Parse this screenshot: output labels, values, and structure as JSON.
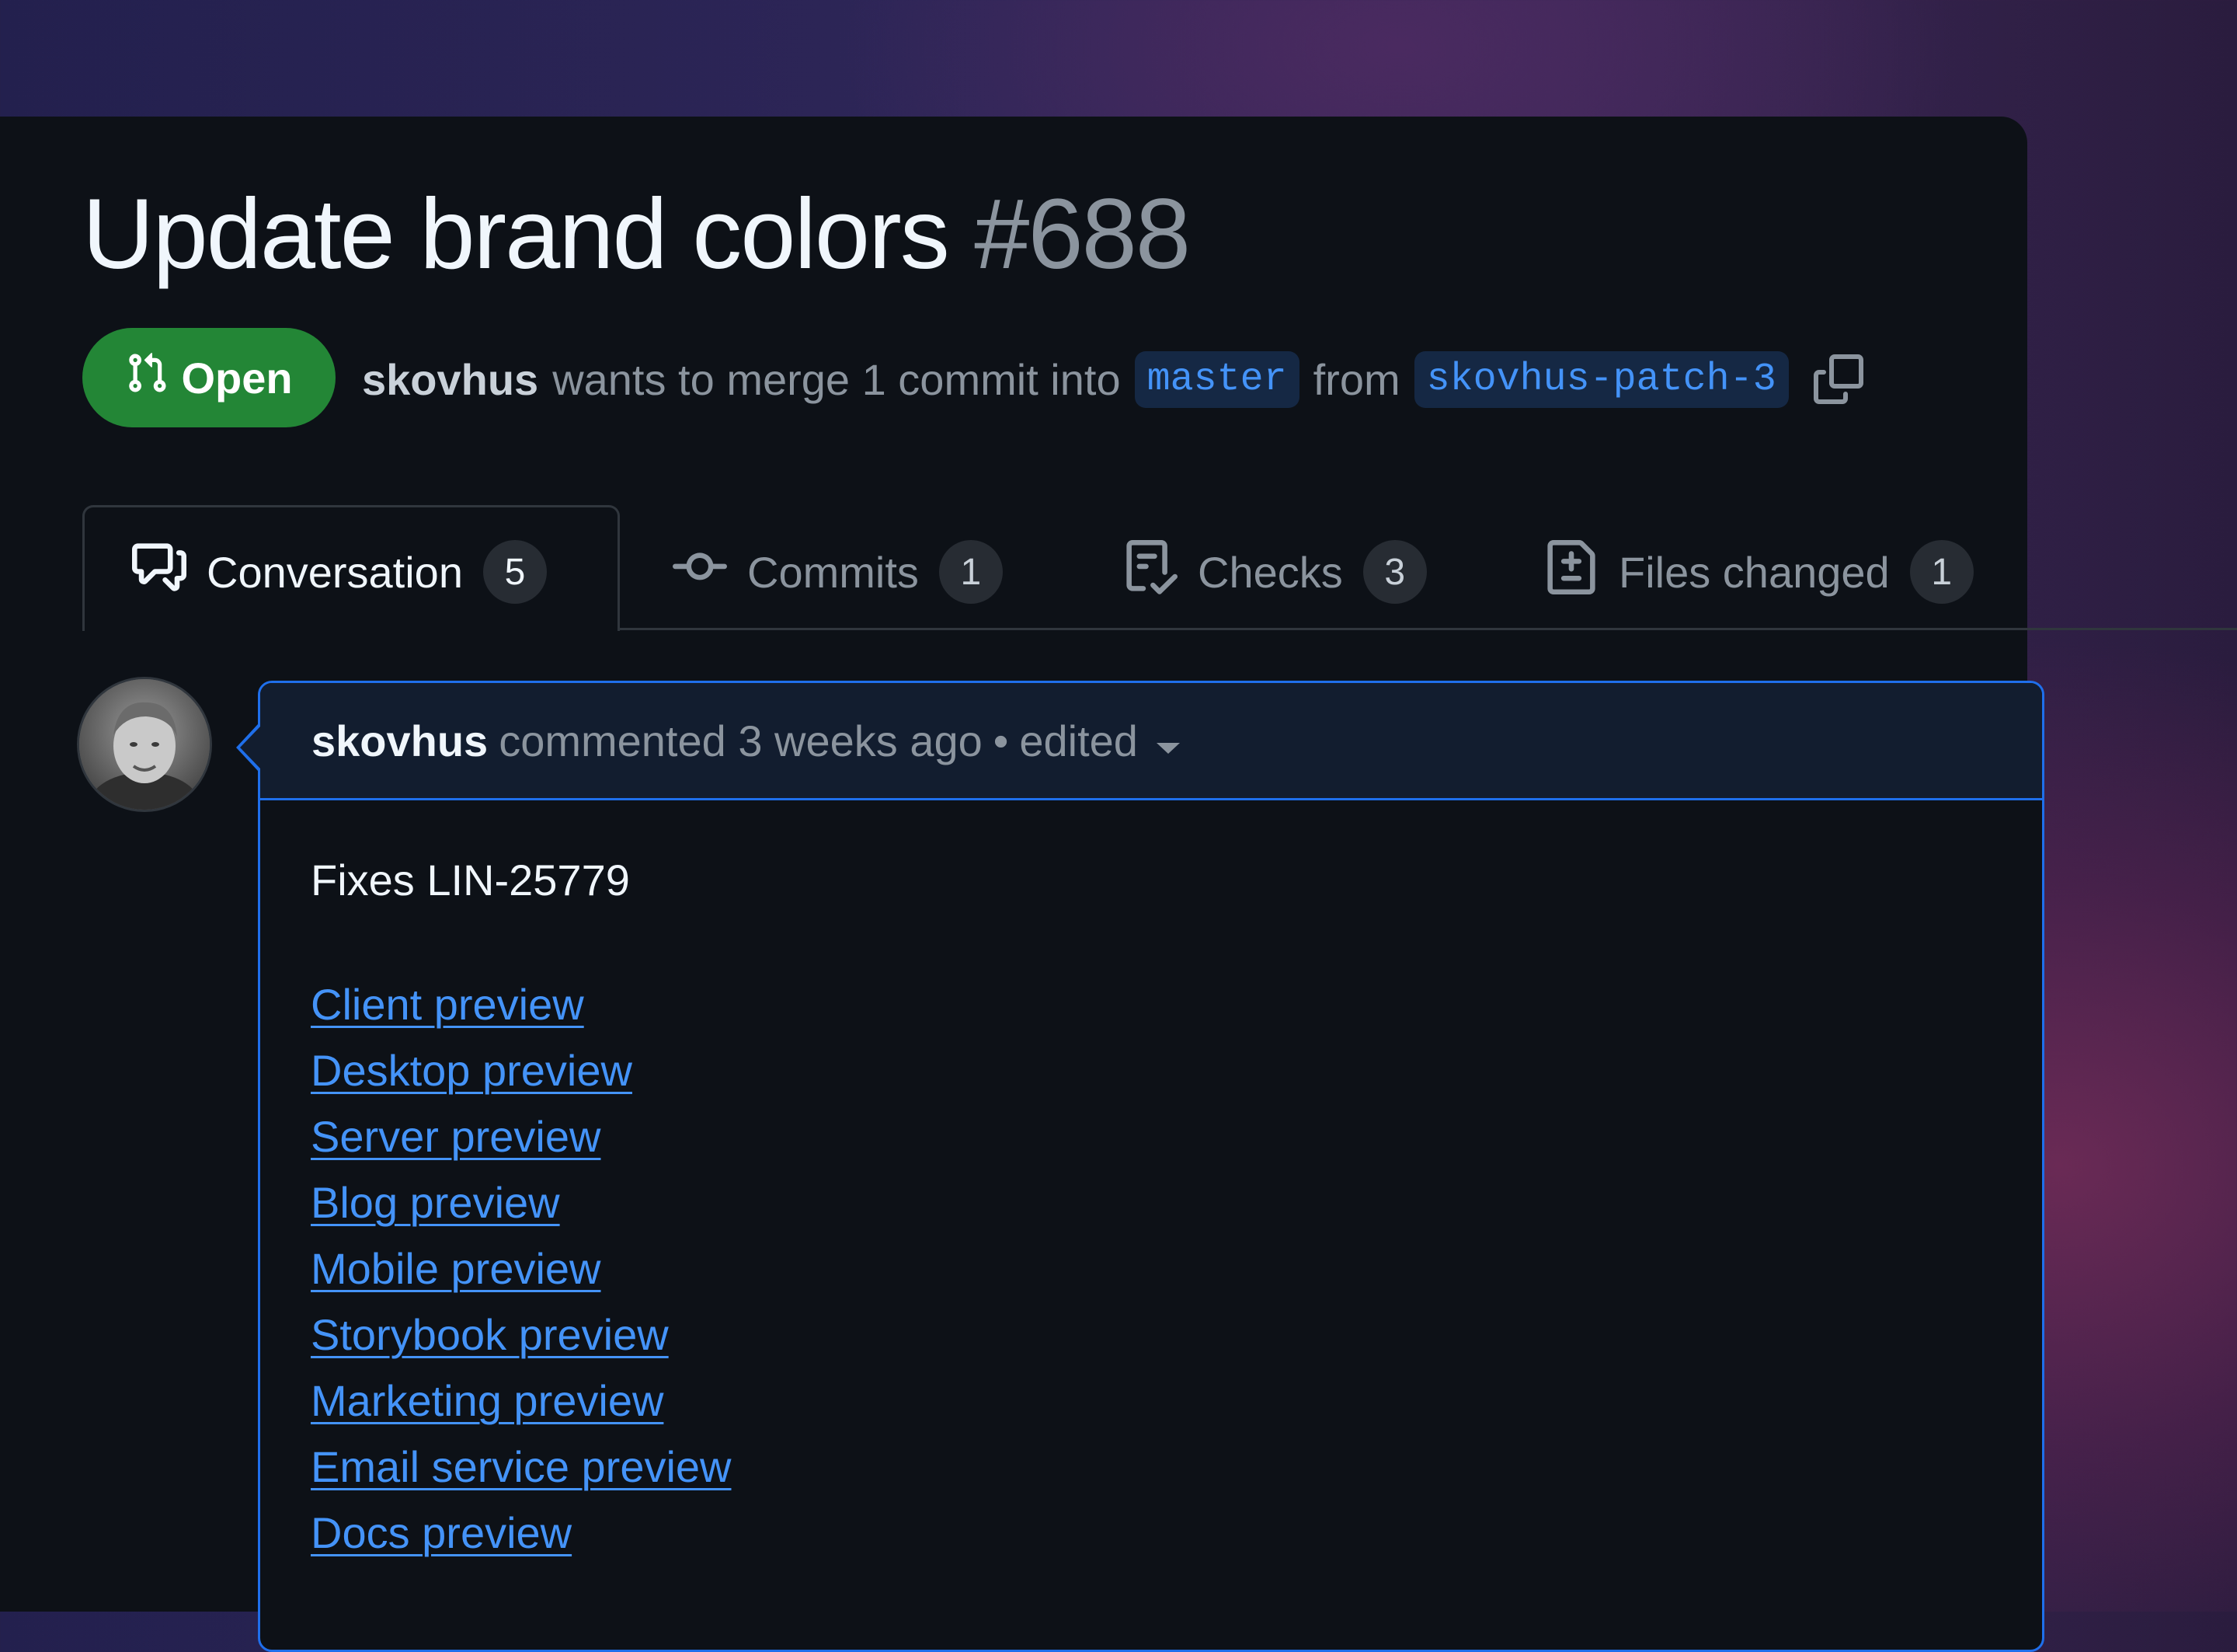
{
  "pr": {
    "title": "Update brand colors",
    "number": "#688",
    "state": "Open",
    "author": "skovhus",
    "merge_text": "wants to merge 1 commit into",
    "base_branch": "master",
    "from_text": "from",
    "head_branch": "skovhus-patch-3"
  },
  "tabs": [
    {
      "label": "Conversation",
      "count": "5",
      "icon": "comment-discussion-icon"
    },
    {
      "label": "Commits",
      "count": "1",
      "icon": "git-commit-icon"
    },
    {
      "label": "Checks",
      "count": "3",
      "icon": "checklist-icon"
    },
    {
      "label": "Files changed",
      "count": "1",
      "icon": "file-diff-icon"
    }
  ],
  "comment": {
    "author": "skovhus",
    "action": "commented 3 weeks ago",
    "separator": "•",
    "edited": "edited",
    "body": "Fixes LIN-25779",
    "links": [
      "Client preview",
      "Desktop preview",
      "Server preview",
      "Blog preview",
      "Mobile preview",
      "Storybook preview",
      "Marketing preview",
      "Email service preview",
      "Docs preview"
    ]
  },
  "colors": {
    "open_green": "#238636",
    "link_blue": "#4493f8",
    "panel_bg": "#0d1117",
    "comment_border": "#1f6feb"
  }
}
